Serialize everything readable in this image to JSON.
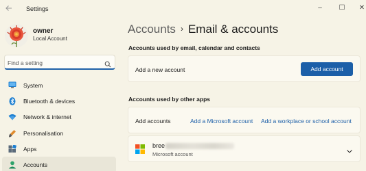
{
  "window": {
    "title": "Settings",
    "controls": {
      "minimize": "–",
      "maximize": "☐",
      "close": "✕"
    }
  },
  "profile": {
    "name": "owner",
    "account_type": "Local Account"
  },
  "search": {
    "placeholder": "Find a setting"
  },
  "sidebar": {
    "items": [
      {
        "label": "System",
        "icon": "monitor-icon",
        "active": false
      },
      {
        "label": "Bluetooth & devices",
        "icon": "bluetooth-icon",
        "active": false
      },
      {
        "label": "Network & internet",
        "icon": "wifi-icon",
        "active": false
      },
      {
        "label": "Personalisation",
        "icon": "paintbrush-icon",
        "active": false
      },
      {
        "label": "Apps",
        "icon": "apps-icon",
        "active": false
      },
      {
        "label": "Accounts",
        "icon": "person-icon",
        "active": true
      }
    ]
  },
  "breadcrumb": {
    "parent": "Accounts",
    "separator": "›",
    "current": "Email & accounts"
  },
  "email_section": {
    "heading": "Accounts used by email, calendar and contacts",
    "row_label": "Add a new account",
    "button_label": "Add account"
  },
  "other_apps_section": {
    "heading": "Accounts used by other apps",
    "row_label": "Add accounts",
    "microsoft_link": "Add a Microsoft account",
    "work_link": "Add a workplace or school account"
  },
  "account": {
    "name_prefix": "bree",
    "type": "Microsoft account"
  },
  "colors": {
    "accent": "#1c5fa8",
    "background": "#f6f3e6",
    "card": "#fbf9f0"
  }
}
